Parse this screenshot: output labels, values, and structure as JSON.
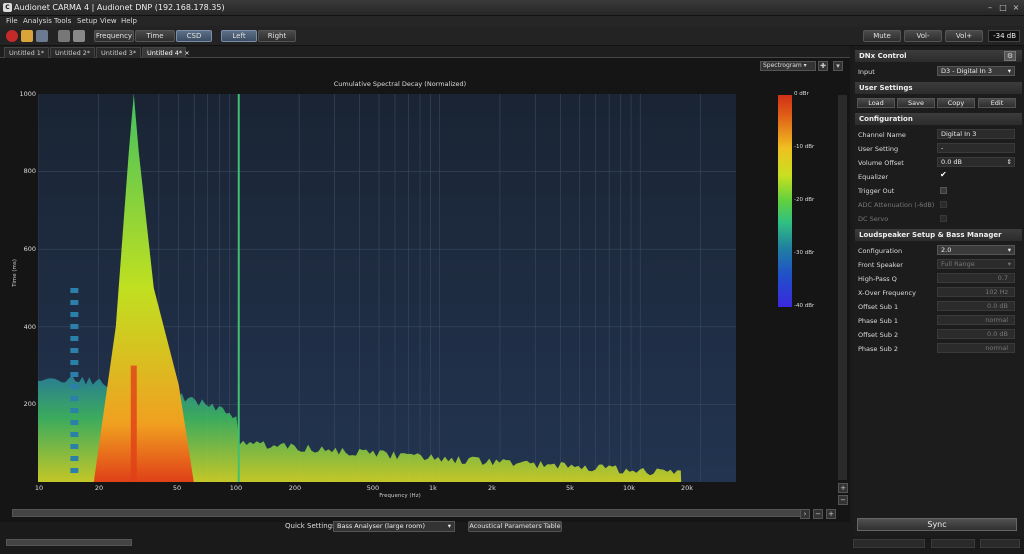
{
  "window": {
    "title": "Audionet CARMA 4 | Audionet DNP (192.168.178.35)",
    "logo": "C",
    "minimize": "–",
    "maximize": "□",
    "close": "×"
  },
  "menu": [
    "File",
    "Analysis",
    "Tools",
    "Setup",
    "View",
    "Help"
  ],
  "toolbar": {
    "buttons": [
      "Frequency",
      "Time",
      "CSD",
      "Left",
      "Right"
    ],
    "mute": "Mute",
    "vol_down": "Vol-",
    "vol_up": "Vol+",
    "volume": "-34 dB"
  },
  "tabs": [
    "Untitled 1*",
    "Untitled 2*",
    "Untitled 3*",
    "Untitled 4*"
  ],
  "tab_close": "×",
  "plot": {
    "view": "Spectrogram",
    "title": "Cumulative Spectral Decay (Normalized)",
    "ylabel": "Time (ms)",
    "xlabel": "Frequency (Hz)",
    "yticks": [
      "1000",
      "800",
      "600",
      "400",
      "200"
    ],
    "xticks": [
      "10",
      "20",
      "50",
      "100",
      "200",
      "500",
      "1k",
      "2k",
      "5k",
      "10k",
      "20k"
    ],
    "colorbar": [
      "0 dBr",
      "-10 dBr",
      "-20 dBr",
      "-30 dBr",
      "-40 dBr"
    ]
  },
  "chart_data": {
    "type": "heatmap",
    "title": "Cumulative Spectral Decay (Normalized)",
    "xlabel": "Frequency (Hz)",
    "ylabel": "Time (ms)",
    "xscale": "log",
    "xlim": [
      10,
      30000
    ],
    "ylim": [
      0,
      1000
    ],
    "color_range_dBr": [
      0,
      -40
    ],
    "ridges": [
      {
        "freq_hz": 30,
        "decay_ms": 1000
      },
      {
        "freq_hz": 100,
        "decay_ms": 1000
      }
    ]
  },
  "bottom": {
    "quick_label": "Quick Settings",
    "quick_value": "Bass Analyser (large room)",
    "acoustic_btn": "Acoustical Parameters Table"
  },
  "side": {
    "dnx": {
      "title": "DNx Control",
      "input_label": "Input",
      "input_value": "D3 - Digital In 3"
    },
    "user": {
      "title": "User Settings",
      "buttons": [
        "Load",
        "Save",
        "Copy",
        "Edit"
      ]
    },
    "config": {
      "title": "Configuration",
      "rows": [
        {
          "label": "Channel Name",
          "value": "Digital In 3"
        },
        {
          "label": "User Setting",
          "value": "-"
        },
        {
          "label": "Volume Offset",
          "value": "0.0 dB"
        }
      ],
      "checks": [
        {
          "label": "Equalizer",
          "checked": "✔"
        },
        {
          "label": "Trigger Out"
        },
        {
          "label": "ADC Attenuation (-6dB)"
        },
        {
          "label": "DC Servo"
        }
      ]
    },
    "ls": {
      "title": "Loudspeaker Setup & Bass Manager",
      "rows": [
        {
          "label": "Configuration",
          "value": "2.0"
        },
        {
          "label": "Front Speaker",
          "value": "Full Range"
        },
        {
          "label": "High-Pass Q",
          "value": "0.7"
        },
        {
          "label": "X-Over Frequency",
          "value": "102 Hz"
        },
        {
          "label": "Offset Sub 1",
          "value": "0.0 dB"
        },
        {
          "label": "Phase Sub 1",
          "value": "normal"
        },
        {
          "label": "Offset Sub 2",
          "value": "0.0 dB"
        },
        {
          "label": "Phase Sub 2",
          "value": "normal"
        }
      ]
    },
    "sync": "Sync"
  }
}
